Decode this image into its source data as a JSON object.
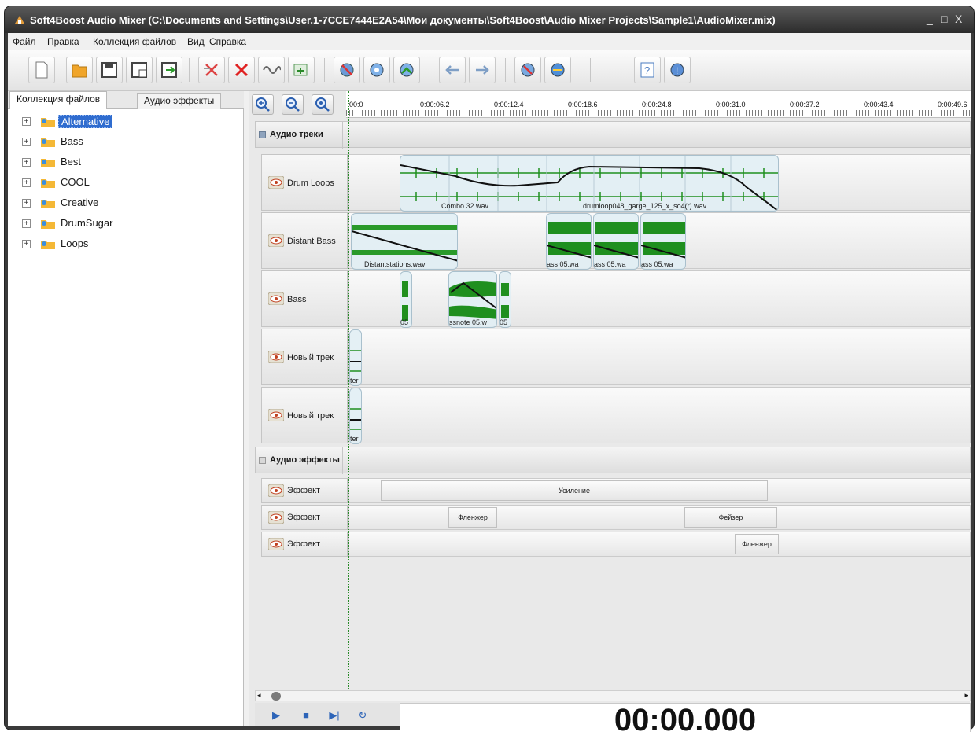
{
  "window": {
    "title": "Soft4Boost Audio Mixer (C:\\Documents and Settings\\User.1-7CCE7444E2A54\\Мои документы\\Soft4Boost\\Audio Mixer Projects\\Sample1\\AudioMixer.mix)",
    "minimize": "_",
    "maximize": "□",
    "close": "X"
  },
  "menu": [
    "Файл",
    "Правка",
    "Коллекция файлов",
    "Вид",
    "Справка"
  ],
  "left_panel": {
    "tabs": [
      "Коллекция файлов",
      "Аудио эффекты"
    ],
    "active_tab": 0,
    "tree": [
      {
        "label": "Alternative",
        "selected": true
      },
      {
        "label": "Bass",
        "selected": false
      },
      {
        "label": "Best",
        "selected": false
      },
      {
        "label": "COOL",
        "selected": false
      },
      {
        "label": "Creative",
        "selected": false
      },
      {
        "label": "DrumSugar",
        "selected": false
      },
      {
        "label": "Loops",
        "selected": false
      }
    ]
  },
  "ruler": {
    "ticks": [
      "00:0",
      "0:00:06.2",
      "0:00:12.4",
      "0:00:18.6",
      "0:00:24.8",
      "0:00:31.0",
      "0:00:37.2",
      "0:00:43.4",
      "0:00:49.6"
    ]
  },
  "sections": {
    "audio_tracks": "Аудио треки",
    "audio_effects": "Аудио эффекты"
  },
  "tracks": [
    {
      "name": "Drum Loops",
      "clips": [
        "Combo 32.wav",
        "drumloop048_garge_125_x_so4(r).wav"
      ]
    },
    {
      "name": "Distant Bass",
      "clips": [
        "Distantstations.wav",
        "ass 05.wa",
        "ass 05.wa",
        "ass 05.wa"
      ]
    },
    {
      "name": "Bass",
      "clips": [
        "05",
        "ssnote 05.w",
        "05"
      ]
    },
    {
      "name": "Новый трек",
      "clips": [
        "ter"
      ]
    },
    {
      "name": "Новый трек",
      "clips": [
        "ter"
      ]
    }
  ],
  "effects": [
    {
      "name": "Эффект",
      "blocks": [
        "Усиление"
      ]
    },
    {
      "name": "Эффект",
      "blocks": [
        "Фленжер",
        "Фейзер"
      ]
    },
    {
      "name": "Эффект",
      "blocks": [
        "Фленжер"
      ]
    }
  ],
  "transport": {
    "play": "▶",
    "stop": "■",
    "step": "▶|",
    "loop": "↻"
  },
  "clock": "00:00.000",
  "icons": {
    "toolbar": [
      "new-icon",
      "open-icon",
      "save-icon",
      "save-as-icon",
      "export-icon",
      "delete-all-icon",
      "delete-icon",
      "split-icon",
      "add-clip-icon",
      "settings-icon",
      "effects-icon",
      "mix-icon",
      "undo-icon",
      "redo-icon",
      "mute-icon",
      "web-icon",
      "help-icon",
      "about-icon"
    ],
    "zoom": [
      "zoom-in-icon",
      "zoom-out-icon",
      "zoom-fit-icon"
    ]
  },
  "colors": {
    "selection": "#2f6ccf",
    "wave": "#1f8f1f",
    "envelope": "#111111"
  }
}
